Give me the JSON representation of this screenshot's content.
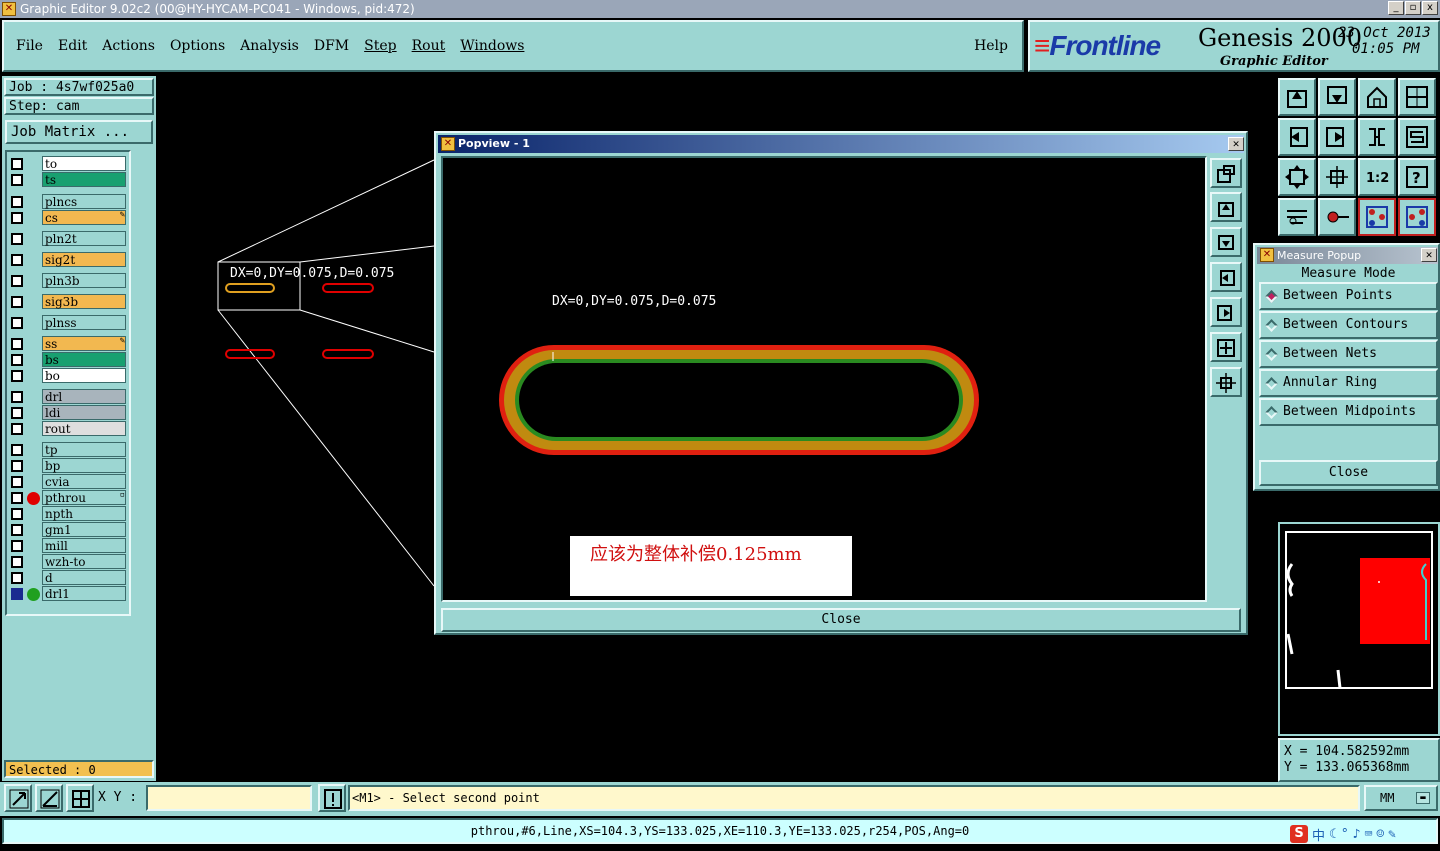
{
  "window": {
    "title": "Graphic Editor 9.02c2 (00@HY-HYCAM-PC041 - Windows, pid:472)",
    "controls": [
      "_",
      "▫",
      "x"
    ]
  },
  "menu": {
    "items": [
      {
        "label": "File",
        "key": "F"
      },
      {
        "label": "Edit",
        "key": "E"
      },
      {
        "label": "Actions",
        "key": "A"
      },
      {
        "label": "Options",
        "key": "O"
      },
      {
        "label": "Analysis",
        "key": "A"
      },
      {
        "label": "DFM",
        "key": "D"
      },
      {
        "label": "Step",
        "key": "S"
      },
      {
        "label": "Rout",
        "key": "R"
      },
      {
        "label": "Windows",
        "key": "W"
      }
    ],
    "help": "Help"
  },
  "brand": {
    "logo": "Frontline",
    "product": "Genesis 2000",
    "subtitle": "Graphic Editor",
    "date": "23 Oct 2013",
    "time": "01:05 PM"
  },
  "job": {
    "job_line": "Job : 4s7wf025a0",
    "step_line": "Step: cam",
    "matrix_button": "Job Matrix ..."
  },
  "layers": [
    {
      "name": "to",
      "color": "#ffffff",
      "mark": ""
    },
    {
      "name": "ts",
      "color": "#18a070",
      "mark": ""
    },
    {
      "name": "plncs",
      "color": "#9cd6d2",
      "mark": ""
    },
    {
      "name": "cs",
      "color": "#f2b850",
      "mark": "✎"
    },
    {
      "name": "pln2t",
      "color": "#9cd6d2",
      "mark": ""
    },
    {
      "name": "sig2t",
      "color": "#f2b850",
      "mark": ""
    },
    {
      "name": "pln3b",
      "color": "#9cd6d2",
      "mark": ""
    },
    {
      "name": "sig3b",
      "color": "#f2b850",
      "mark": ""
    },
    {
      "name": "plnss",
      "color": "#9cd6d2",
      "mark": ""
    },
    {
      "name": "ss",
      "color": "#f2b850",
      "mark": "✎"
    },
    {
      "name": "bs",
      "color": "#18a070",
      "mark": ""
    },
    {
      "name": "bo",
      "color": "#ffffff",
      "mark": ""
    },
    {
      "name": "drl",
      "color": "#a8b4bc",
      "mark": ""
    },
    {
      "name": "ldi",
      "color": "#a8b4bc",
      "mark": ""
    },
    {
      "name": "rout",
      "color": "#dedede",
      "mark": ""
    },
    {
      "name": "tp",
      "color": "#9cd6d2",
      "mark": ""
    },
    {
      "name": "bp",
      "color": "#9cd6d2",
      "mark": ""
    },
    {
      "name": "cvia",
      "color": "#9cd6d2",
      "mark": ""
    },
    {
      "name": "pthrou",
      "color": "#9cd6d2",
      "mark": "▫",
      "dot": "#e00000"
    },
    {
      "name": "npth",
      "color": "#9cd6d2",
      "mark": ""
    },
    {
      "name": "gm1",
      "color": "#9cd6d2",
      "mark": ""
    },
    {
      "name": "mill",
      "color": "#9cd6d2",
      "mark": ""
    },
    {
      "name": "wzh-to",
      "color": "#9cd6d2",
      "mark": ""
    },
    {
      "name": "d",
      "color": "#9cd6d2",
      "mark": ""
    },
    {
      "name": "drl1",
      "color": "#9cd6d2",
      "mark": "",
      "dot": "#20a020",
      "checked": true
    }
  ],
  "selected": "Selected : 0",
  "main_measure_label": "DX=0,DY=0.075,D=0.075",
  "popview": {
    "title": "Popview - 1",
    "measure_label": "DX=0,DY=0.075,D=0.075",
    "annotation": "应该为整体补偿0.125mm",
    "close": "Close"
  },
  "measure_popup": {
    "title": "Measure Popup",
    "mode_label": "Measure Mode",
    "options": [
      {
        "label": "Between Points",
        "selected": true
      },
      {
        "label": "Between Contours",
        "selected": false
      },
      {
        "label": "Between Nets",
        "selected": false
      },
      {
        "label": "Annular Ring",
        "selected": false
      },
      {
        "label": "Between Midpoints",
        "selected": false
      }
    ],
    "close": "Close"
  },
  "coords": {
    "x": "X  =  104.582592mm",
    "y": "Y  =  133.065368mm"
  },
  "bottom": {
    "xy_label": "X Y :",
    "xy_value": "",
    "message": "<M1> - Select second point",
    "units": "MM"
  },
  "status": "pthrou,#6,Line,XS=104.3,YS=133.025,XE=110.3,YE=133.025,r254,POS,Ang=0",
  "ime": {
    "logo": "S",
    "lang": "中"
  }
}
